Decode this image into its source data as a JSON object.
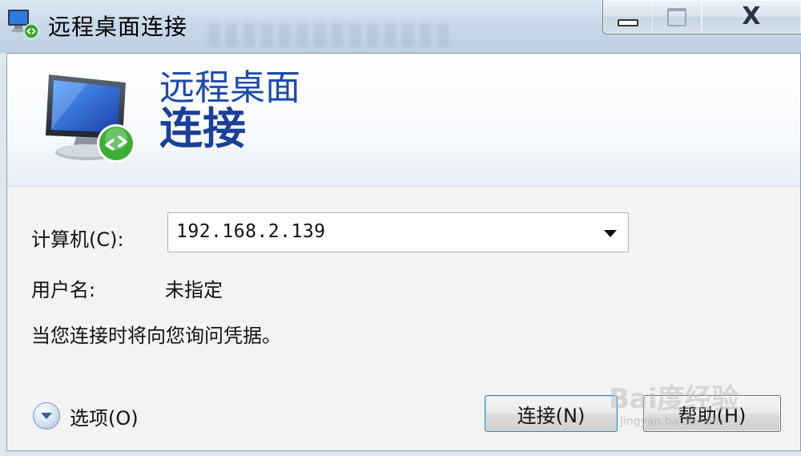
{
  "window": {
    "title": "远程桌面连接",
    "controls": {
      "minimize": "minimize",
      "maximize": "maximize",
      "close": "close"
    }
  },
  "banner": {
    "line1": "远程桌面",
    "line2": "连接"
  },
  "form": {
    "computer_label": "计算机(C):",
    "computer_value": "192.168.2.139",
    "user_label": "用户名:",
    "user_value": "未指定",
    "hint": "当您连接时将向您询问凭据。"
  },
  "footer": {
    "options_label": "选项(O)",
    "connect_label": "连接(N)",
    "help_label": "帮助(H)"
  },
  "icons": {
    "app": "remote-desktop-icon",
    "banner": "monitor-connection-icon",
    "options": "chevron-down-circle-icon",
    "combo": "dropdown-arrow-icon"
  },
  "watermark": {
    "main": "Bai度经验",
    "sub": "jingyan.baidu.com"
  },
  "colors": {
    "banner_text": "#1e4ba8",
    "titlebar": "#c9d9ea"
  }
}
